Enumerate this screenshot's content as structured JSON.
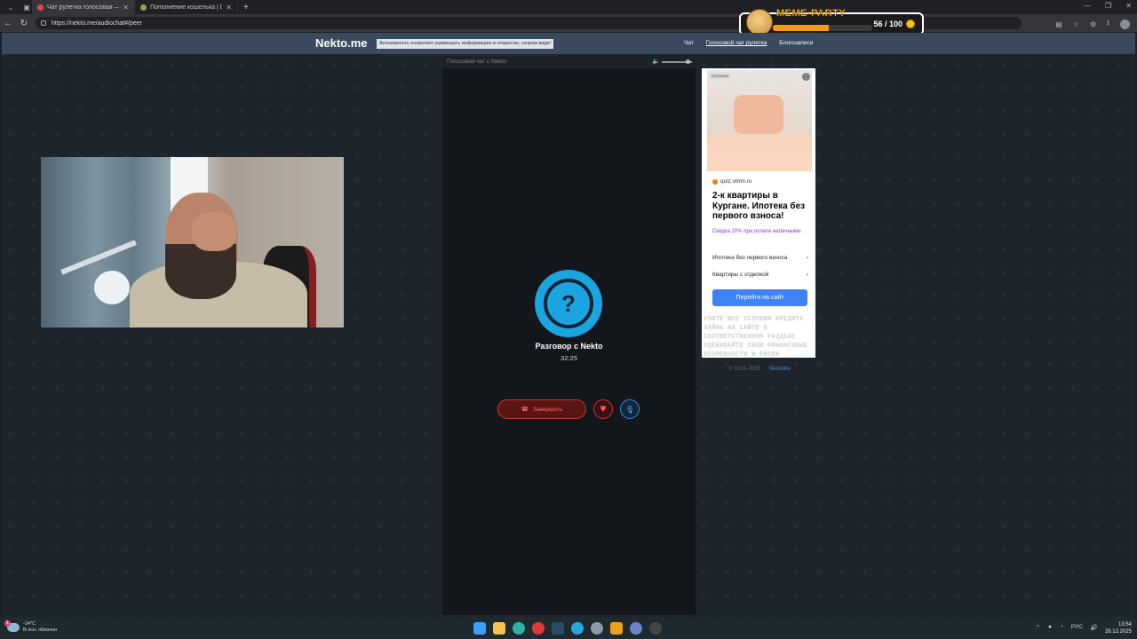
{
  "browser": {
    "tabs": [
      {
        "title": "Чат рулетка голосовая — N",
        "active": true
      },
      {
        "title": "Пополнение кошелька | Dragon",
        "active": false
      }
    ],
    "url": "https://nekto.me/audiochat#/peer"
  },
  "overlay": {
    "title": "MEME·PARTY",
    "progress_text": "56 / 100",
    "progress_fraction": 0.56
  },
  "site": {
    "logo": "Nekto.me",
    "anon_notice": "Анонимность позволяет размещать информацию в открытом, скором виде!",
    "menu": [
      "Чат",
      "Голосовой чат рулетка",
      "Блогозаписи"
    ]
  },
  "chat": {
    "header": "Голосовой чат с Nekto",
    "title": "Разговор с Nekto",
    "timer": "32:25",
    "end_button": "Завершить"
  },
  "ad": {
    "tag": "РЕКЛАМА",
    "domain": "quiz.vtmn.ru",
    "headline": "2-к квартиры в Кургане. Ипотека без первого взноса!",
    "discount": "Скидка 20% при оплате наличными",
    "links": [
      "Ипотека без первого взноса",
      "Квартиры с отделкой"
    ],
    "cta": "Перейти на сайт",
    "legal": "УЧИТЕ ВСЕ УСЛОВИЯ КРЕДИТА ЗАЙМА НА САЙТЕ В СООТВЕТСТВЕННОМ РАЗДЕЛЕ ОЦЕНИВАЙТЕ СВОИ ФИНАНСОВЫЕ ВОЗМОЖНОСТИ И РИСКИ"
  },
  "footer": {
    "copyright": "© 2013–2025",
    "link": "NektoMe"
  },
  "taskbar": {
    "weather_temp": "-14°C",
    "weather_desc": "В осн. облачно",
    "notif_count": "1",
    "lang": "РУС",
    "time": "13:54",
    "date": "28.12.2025"
  }
}
